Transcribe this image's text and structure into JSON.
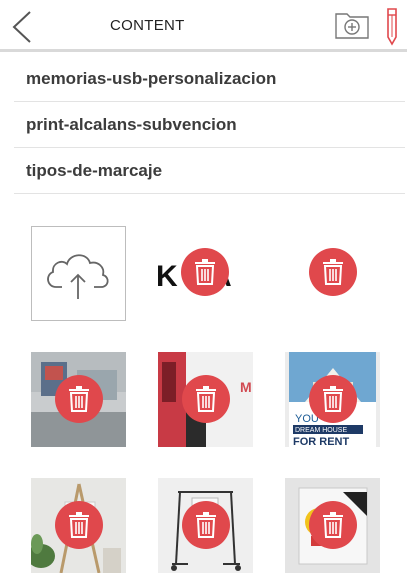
{
  "header": {
    "title": "CONTENT",
    "icons": [
      "back-icon",
      "folder-add-icon",
      "pencil-icon"
    ]
  },
  "folders": [
    {
      "label": "memorias-usb-personalizacion"
    },
    {
      "label": "print-alcalans-subvencion"
    },
    {
      "label": "tipos-de-marcaje"
    }
  ],
  "thumbs": {
    "kia_text": "KIA",
    "poster_text1": "YOU",
    "poster_text2": "DREAM HOUSE",
    "poster_text3": "FOR RENT",
    "shop_letter": "M"
  },
  "colors": {
    "accent": "#e0484c",
    "divider": "#d9d9d9"
  }
}
